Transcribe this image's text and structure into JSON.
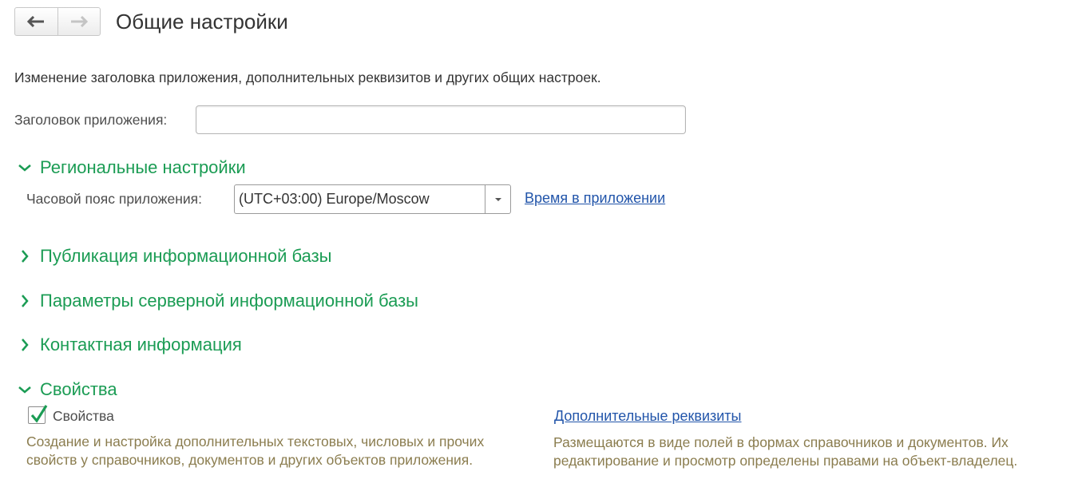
{
  "header": {
    "back_icon": "arrow-left-icon",
    "forward_icon": "arrow-right-icon",
    "title": "Общие настройки"
  },
  "intro": {
    "description": "Изменение заголовка приложения, дополнительных реквизитов и других общих настроек.",
    "app_title_label": "Заголовок приложения:",
    "app_title_value": ""
  },
  "groups": {
    "regional": {
      "label": "Региональные настройки",
      "expanded": true
    },
    "publication": {
      "label": "Публикация информационной базы",
      "expanded": false
    },
    "server_params": {
      "label": "Параметры серверной информационной базы",
      "expanded": false
    },
    "contact_info": {
      "label": "Контактная информация",
      "expanded": false
    },
    "properties": {
      "label": "Свойства",
      "expanded": true
    }
  },
  "regional": {
    "timezone_label": "Часовой пояс приложения:",
    "timezone_value": "(UTC+03:00) Europe/Moscow",
    "time_link": "Время в приложении"
  },
  "properties": {
    "checkbox_label": "Свойства",
    "checked": true,
    "checkbox_hint": "Создание и настройка дополнительных текстовых, числовых и прочих свойств у справочников, документов и других объектов приложения.",
    "additional_link": "Дополнительные реквизиты",
    "additional_hint": "Размещаются в виде полей в формах справочников и документов. Их редактирование и просмотр определены правами на объект-владелец."
  },
  "colors": {
    "group_header": "#1b9c54",
    "link": "#2255aa",
    "hint": "#8b7d4f",
    "checkmark": "#1b9c54"
  }
}
